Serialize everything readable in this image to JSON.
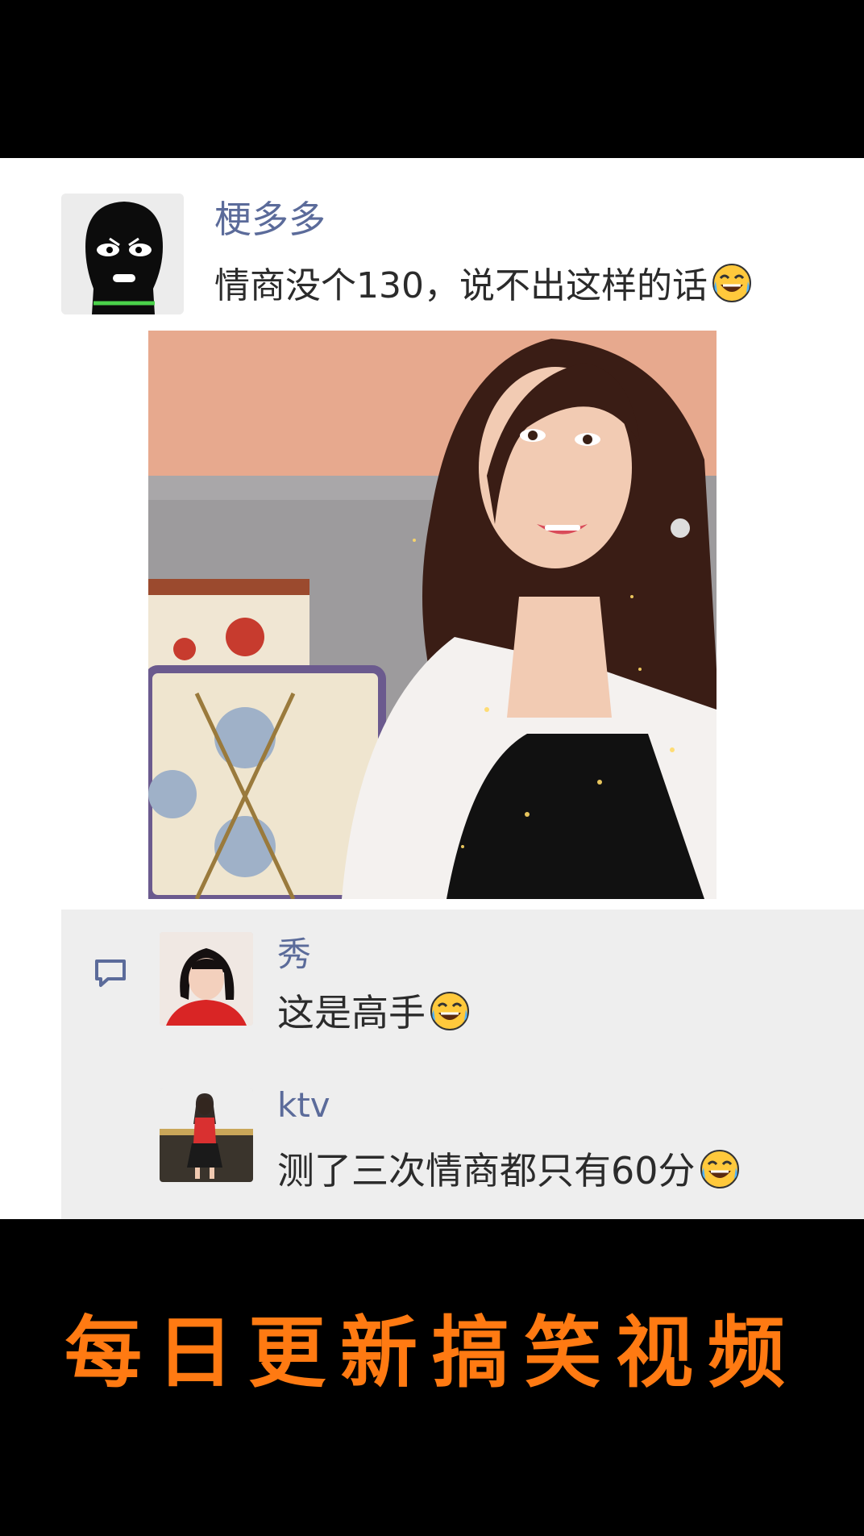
{
  "post": {
    "username": "梗多多",
    "text": "情商没个130，说不出这样的话",
    "text_emoji": "tears-of-joy-emoji"
  },
  "comments": [
    {
      "name": "秀",
      "text": "这是高手",
      "emoji": "tears-of-joy-emoji"
    },
    {
      "name": "ktv",
      "text": "测了三次情商都只有60分",
      "emoji": "tears-of-joy-emoji"
    }
  ],
  "banner": {
    "text": "每日更新搞笑视频"
  },
  "colors": {
    "accent_name": "#5b6b9a",
    "banner": "#ff7a12",
    "background": "#000000",
    "comment_bg": "#eeeeee"
  },
  "icons": {
    "comment": "speech-bubble-icon"
  }
}
